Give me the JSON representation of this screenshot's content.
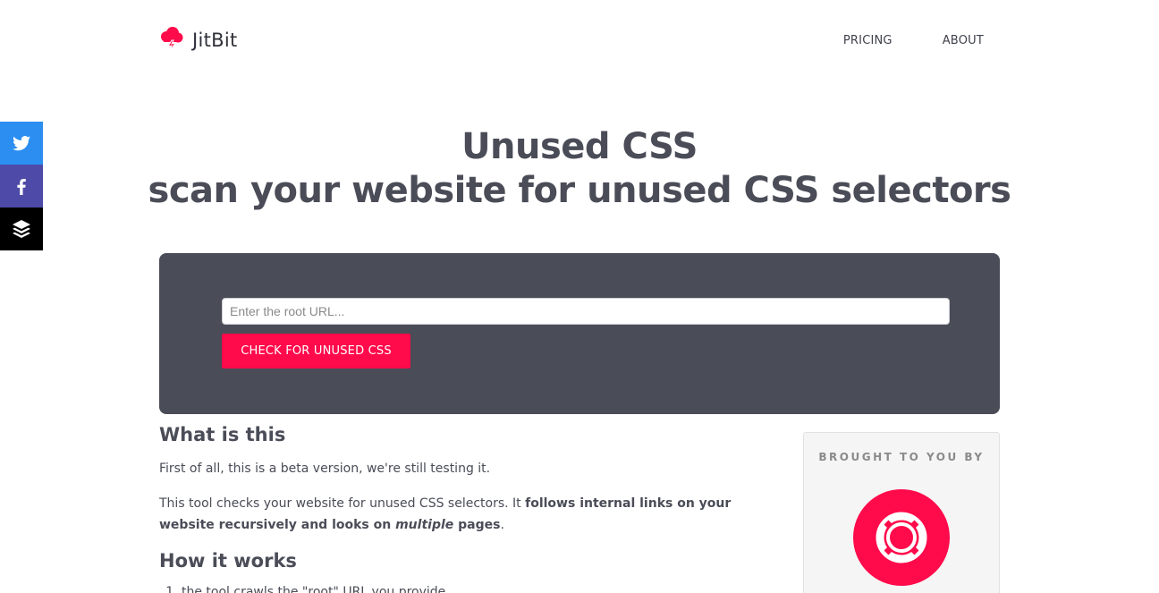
{
  "header": {
    "brand": "JitBit",
    "nav": [
      {
        "label": "PRICING"
      },
      {
        "label": "ABOUT"
      }
    ]
  },
  "social": [
    {
      "icon": "twitter-icon",
      "color": "#2b8ef0"
    },
    {
      "icon": "facebook-icon",
      "color": "#4d4aa8"
    },
    {
      "icon": "buffer-icon",
      "color": "#000000"
    }
  ],
  "hero": {
    "title_line1": "Unused CSS",
    "title_line2": "scan your website for unused CSS selectors"
  },
  "form": {
    "url_value": "",
    "url_placeholder": "Enter the root URL...",
    "submit_label": "CHECK FOR UNUSED CSS"
  },
  "content": {
    "what_heading": "What is this",
    "p1": "First of all, this is a beta version, we're still testing it.",
    "p2_start": "This tool checks your website for unused CSS selectors. It ",
    "p2_bold": "follows internal links on your website recursively and looks on ",
    "p2_italic": "multiple",
    "p2_bold_end": " pages",
    "p2_end": ".",
    "how_heading": "How it works",
    "steps": [
      "the tool crawls the \"root\" URL you provide"
    ]
  },
  "sidebar": {
    "title": "BROUGHT TO YOU BY",
    "logo_icon": "lifebuoy-icon"
  },
  "colors": {
    "accent": "#ff0a4b",
    "panel": "#4a4c57",
    "text": "#4a4c57"
  }
}
